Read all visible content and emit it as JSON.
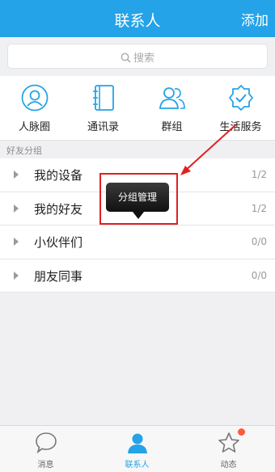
{
  "header": {
    "title": "联系人",
    "add_label": "添加"
  },
  "search": {
    "placeholder": "搜索"
  },
  "quick_actions": [
    {
      "label": "人脉圈",
      "icon": "person-circle-icon"
    },
    {
      "label": "通讯录",
      "icon": "address-book-icon"
    },
    {
      "label": "群组",
      "icon": "group-icon"
    },
    {
      "label": "生活服务",
      "icon": "verified-shield-icon"
    }
  ],
  "section": {
    "title": "好友分组"
  },
  "groups": [
    {
      "name": "我的设备",
      "count": "1/2"
    },
    {
      "name": "我的好友",
      "count": "1/2"
    },
    {
      "name": "小伙伴们",
      "count": "0/0"
    },
    {
      "name": "朋友同事",
      "count": "0/0"
    }
  ],
  "popup": {
    "label": "分组管理"
  },
  "tabs": [
    {
      "label": "消息",
      "icon": "chat-bubble-icon"
    },
    {
      "label": "联系人",
      "icon": "contact-person-icon",
      "active": true
    },
    {
      "label": "动态",
      "icon": "star-icon"
    }
  ],
  "colors": {
    "accent": "#24a3e8",
    "highlight": "#e02020",
    "badge": "#ff5a3c"
  }
}
